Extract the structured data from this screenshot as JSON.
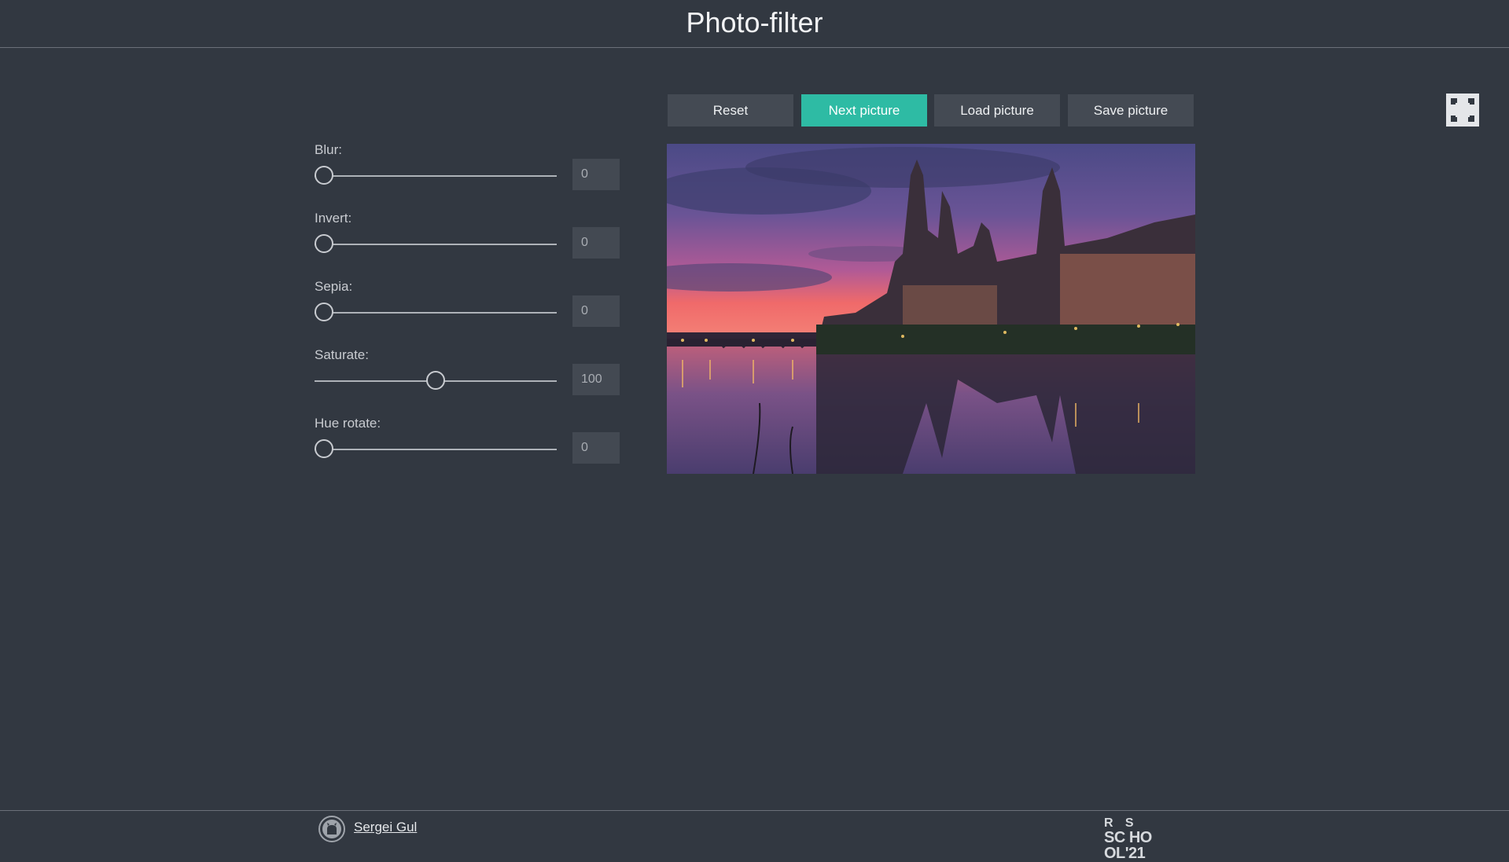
{
  "app": {
    "title": "Photo-filter"
  },
  "fullscreen": {
    "icon": "fullscreen-icon"
  },
  "filters": [
    {
      "label": "Blur:",
      "value": "0",
      "fraction": 0.0
    },
    {
      "label": "Invert:",
      "value": "0",
      "fraction": 0.0
    },
    {
      "label": "Sepia:",
      "value": "0",
      "fraction": 0.0
    },
    {
      "label": "Saturate:",
      "value": "100",
      "fraction": 0.5
    },
    {
      "label": "Hue rotate:",
      "value": "0",
      "fraction": 0.0
    }
  ],
  "toolbar": {
    "reset": "Reset",
    "next": "Next picture",
    "load": "Load picture",
    "save": "Save picture",
    "active": "next"
  },
  "footer": {
    "author": "Sergei Gul",
    "github_icon": "github-icon",
    "school_logo_line1": "R    S",
    "school_logo_line2": "SC HO OL'21"
  },
  "colors": {
    "background": "#323841",
    "accent": "#2ebba4",
    "button": "#444a53"
  }
}
